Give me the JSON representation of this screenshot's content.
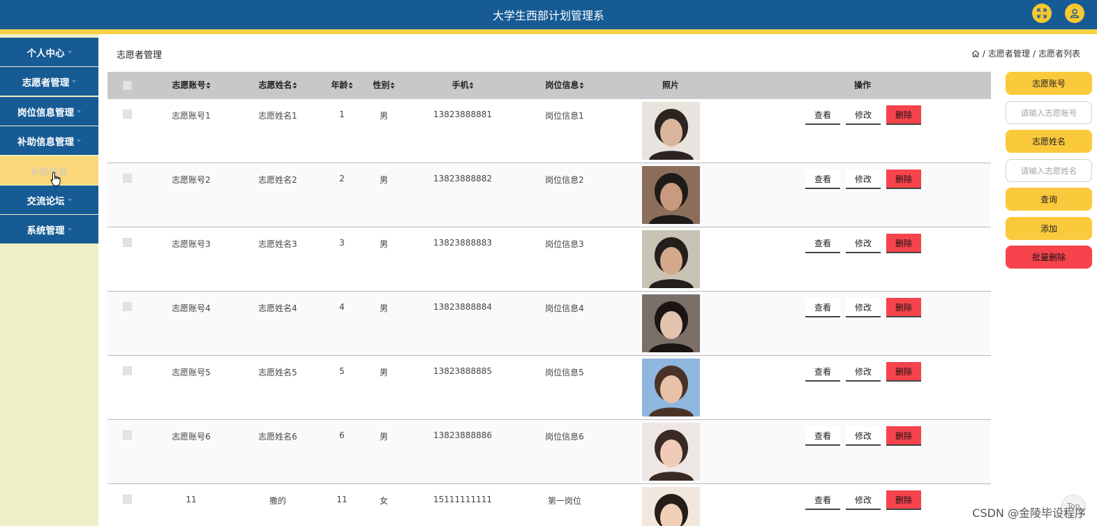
{
  "header": {
    "title": "大学生西部计划管理系",
    "fullscreen_icon": "expand-icon",
    "user_icon": "user-icon",
    "accent": "#f7d046",
    "bg": "#165b94"
  },
  "sidebar": {
    "items": [
      {
        "label": "个人中心"
      },
      {
        "label": "志愿者管理"
      },
      {
        "label": "岗位信息管理"
      },
      {
        "label": "补助信息管理"
      },
      {
        "label": "补助信息",
        "sub": true
      },
      {
        "label": "交流论坛"
      },
      {
        "label": "系统管理"
      }
    ]
  },
  "page": {
    "title": "志愿者管理",
    "breadcrumb": [
      "志愿者管理",
      "志愿者列表"
    ],
    "breadcrumb_sep": "/"
  },
  "table": {
    "columns": [
      "志愿账号",
      "志愿姓名",
      "年龄",
      "性别",
      "手机",
      "岗位信息",
      "照片",
      "操作"
    ],
    "rows": [
      {
        "account": "志愿账号1",
        "name": "志愿姓名1",
        "age": "1",
        "gender": "男",
        "phone": "13823888881",
        "post": "岗位信息1"
      },
      {
        "account": "志愿账号2",
        "name": "志愿姓名2",
        "age": "2",
        "gender": "男",
        "phone": "13823888882",
        "post": "岗位信息2"
      },
      {
        "account": "志愿账号3",
        "name": "志愿姓名3",
        "age": "3",
        "gender": "男",
        "phone": "13823888883",
        "post": "岗位信息3"
      },
      {
        "account": "志愿账号4",
        "name": "志愿姓名4",
        "age": "4",
        "gender": "男",
        "phone": "13823888884",
        "post": "岗位信息4"
      },
      {
        "account": "志愿账号5",
        "name": "志愿姓名5",
        "age": "5",
        "gender": "男",
        "phone": "13823888885",
        "post": "岗位信息5"
      },
      {
        "account": "志愿账号6",
        "name": "志愿姓名6",
        "age": "6",
        "gender": "男",
        "phone": "13823888886",
        "post": "岗位信息6"
      },
      {
        "account": "11",
        "name": "撒的",
        "age": "11",
        "gender": "女",
        "phone": "15111111111",
        "post": "第一岗位"
      }
    ],
    "actions": {
      "view": "查看",
      "edit": "修改",
      "delete": "删除"
    }
  },
  "search_panel": {
    "account_label": "志愿账号",
    "account_placeholder": "请输入志愿账号",
    "name_label": "志愿姓名",
    "name_placeholder": "请输入志愿姓名",
    "query_button": "查询",
    "add_button": "添加",
    "batch_delete_button": "批量删除"
  },
  "watermark": "CSDN @金陵毕设程序",
  "back_to_top": "Top"
}
